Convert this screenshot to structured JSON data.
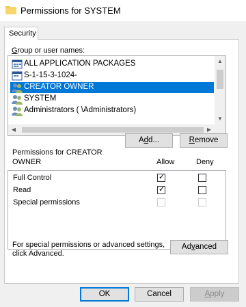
{
  "window": {
    "title": "Permissions for SYSTEM"
  },
  "tabs": [
    {
      "label": "Security"
    }
  ],
  "group_section": {
    "label_accel": "G",
    "label_rest": "roup or user names:",
    "items": [
      {
        "name": "ALL APPLICATION PACKAGES",
        "icon": "app-packages-icon",
        "selected": false
      },
      {
        "name": "S-1-15-3-1024-",
        "icon": "capability-sid-icon",
        "selected": false
      },
      {
        "name": "CREATOR OWNER",
        "icon": "users-group-icon",
        "selected": true
      },
      {
        "name": "SYSTEM",
        "icon": "users-group-icon",
        "selected": false
      },
      {
        "name": "Administrators (                           \\Administrators)",
        "icon": "users-group-icon",
        "selected": false
      }
    ]
  },
  "buttons": {
    "add": {
      "accel": "d",
      "pre": "A",
      "post": "d..."
    },
    "remove": {
      "accel": "R",
      "post": "emove"
    },
    "advanced": {
      "pre": "Ad",
      "accel": "v",
      "post": "anced"
    },
    "ok": "OK",
    "cancel": "Cancel",
    "apply": {
      "accel": "A",
      "post": "pply"
    }
  },
  "permissions": {
    "heading_line1": "Permissions for CREATOR",
    "heading_line2": "OWNER",
    "allow_label": "Allow",
    "deny_label": "Deny",
    "rows": [
      {
        "name": "Full Control",
        "allow": true,
        "deny": false,
        "enabled": true
      },
      {
        "name": "Read",
        "allow": true,
        "deny": false,
        "enabled": true
      },
      {
        "name": "Special permissions",
        "allow": false,
        "deny": false,
        "enabled": false
      }
    ]
  },
  "advanced_hint": {
    "line1": "For special permissions or advanced settings,",
    "line2": "click Advanced."
  },
  "colors": {
    "selection": "#0078d7",
    "dialog_bg": "#f0f0f0"
  }
}
